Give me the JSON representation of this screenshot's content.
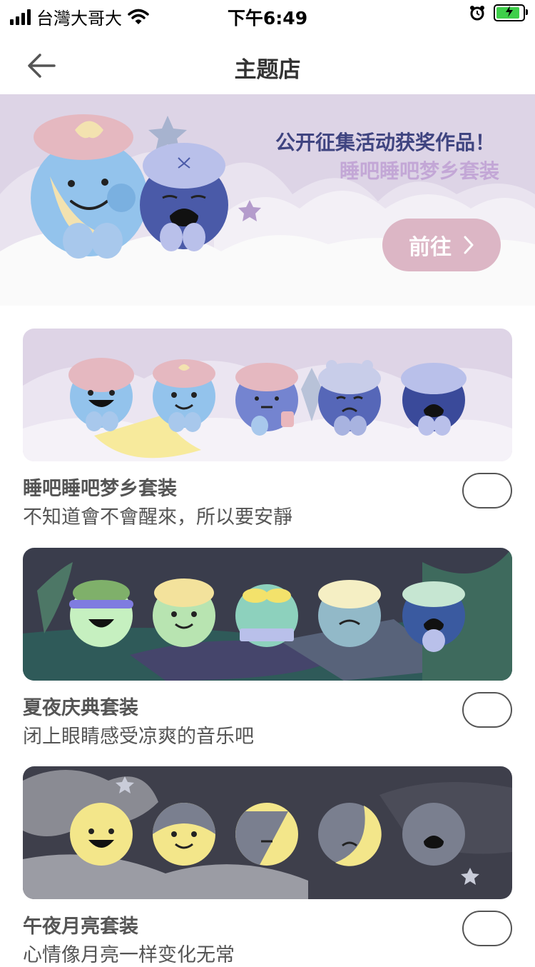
{
  "status_bar": {
    "carrier": "台灣大哥大",
    "time": "下午6:49",
    "signal_icon": "signal-bars-icon",
    "wifi_icon": "wifi-icon",
    "alarm_icon": "alarm-clock-icon",
    "battery_icon": "battery-charging-icon"
  },
  "header": {
    "title": "主题店",
    "back_icon": "arrow-left-icon"
  },
  "banner": {
    "title": "公开征集活动获奖作品！",
    "subtitle": "睡吧睡吧梦乡套装",
    "button_label": "前往",
    "button_icon": "chevron-right-icon"
  },
  "themes": [
    {
      "name": "睡吧睡吧梦乡套装",
      "description": "不知道會不會醒來，所以要安靜",
      "selected": false
    },
    {
      "name": "夏夜庆典套装",
      "description": "闭上眼睛感受凉爽的音乐吧",
      "selected": false
    },
    {
      "name": "午夜月亮套装",
      "description": "心情像月亮一样变化无常",
      "selected": false
    }
  ],
  "colors": {
    "banner_bg": "#ddd4e6",
    "banner_title": "#3f4480",
    "banner_subtitle": "#c3a7d6",
    "button_bg": "#dcb6c5",
    "card1_bg": "#ded4e6",
    "card2_bg": "#3a3d4c",
    "card3_bg": "#3e3f4b"
  }
}
